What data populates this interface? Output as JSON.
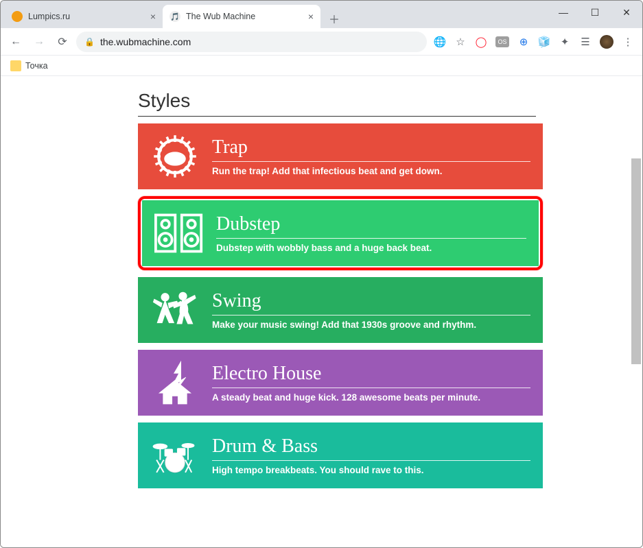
{
  "window": {
    "tabs": [
      {
        "title": "Lumpics.ru",
        "active": false
      },
      {
        "title": "The Wub Machine",
        "active": true
      }
    ]
  },
  "toolbar": {
    "url": "the.wubmachine.com"
  },
  "bookmarks": {
    "items": [
      {
        "label": "Точка"
      }
    ]
  },
  "page": {
    "section_title": "Styles",
    "styles": [
      {
        "name": "Trap",
        "desc": "Run the trap! Add that infectious beat and get down.",
        "color": "c-red",
        "icon": "trap",
        "highlight": false
      },
      {
        "name": "Dubstep",
        "desc": "Dubstep with wobbly bass and a huge back beat.",
        "color": "c-green",
        "icon": "speakers",
        "highlight": true
      },
      {
        "name": "Swing",
        "desc": "Make your music swing! Add that 1930s groove and rhythm.",
        "color": "c-darkgreen",
        "icon": "dancers",
        "highlight": false
      },
      {
        "name": "Electro House",
        "desc": "A steady beat and huge kick. 128 awesome beats per minute.",
        "color": "c-purple",
        "icon": "house",
        "highlight": false
      },
      {
        "name": "Drum & Bass",
        "desc": "High tempo breakbeats. You should rave to this.",
        "color": "c-teal",
        "icon": "drumkit",
        "highlight": false
      }
    ]
  }
}
